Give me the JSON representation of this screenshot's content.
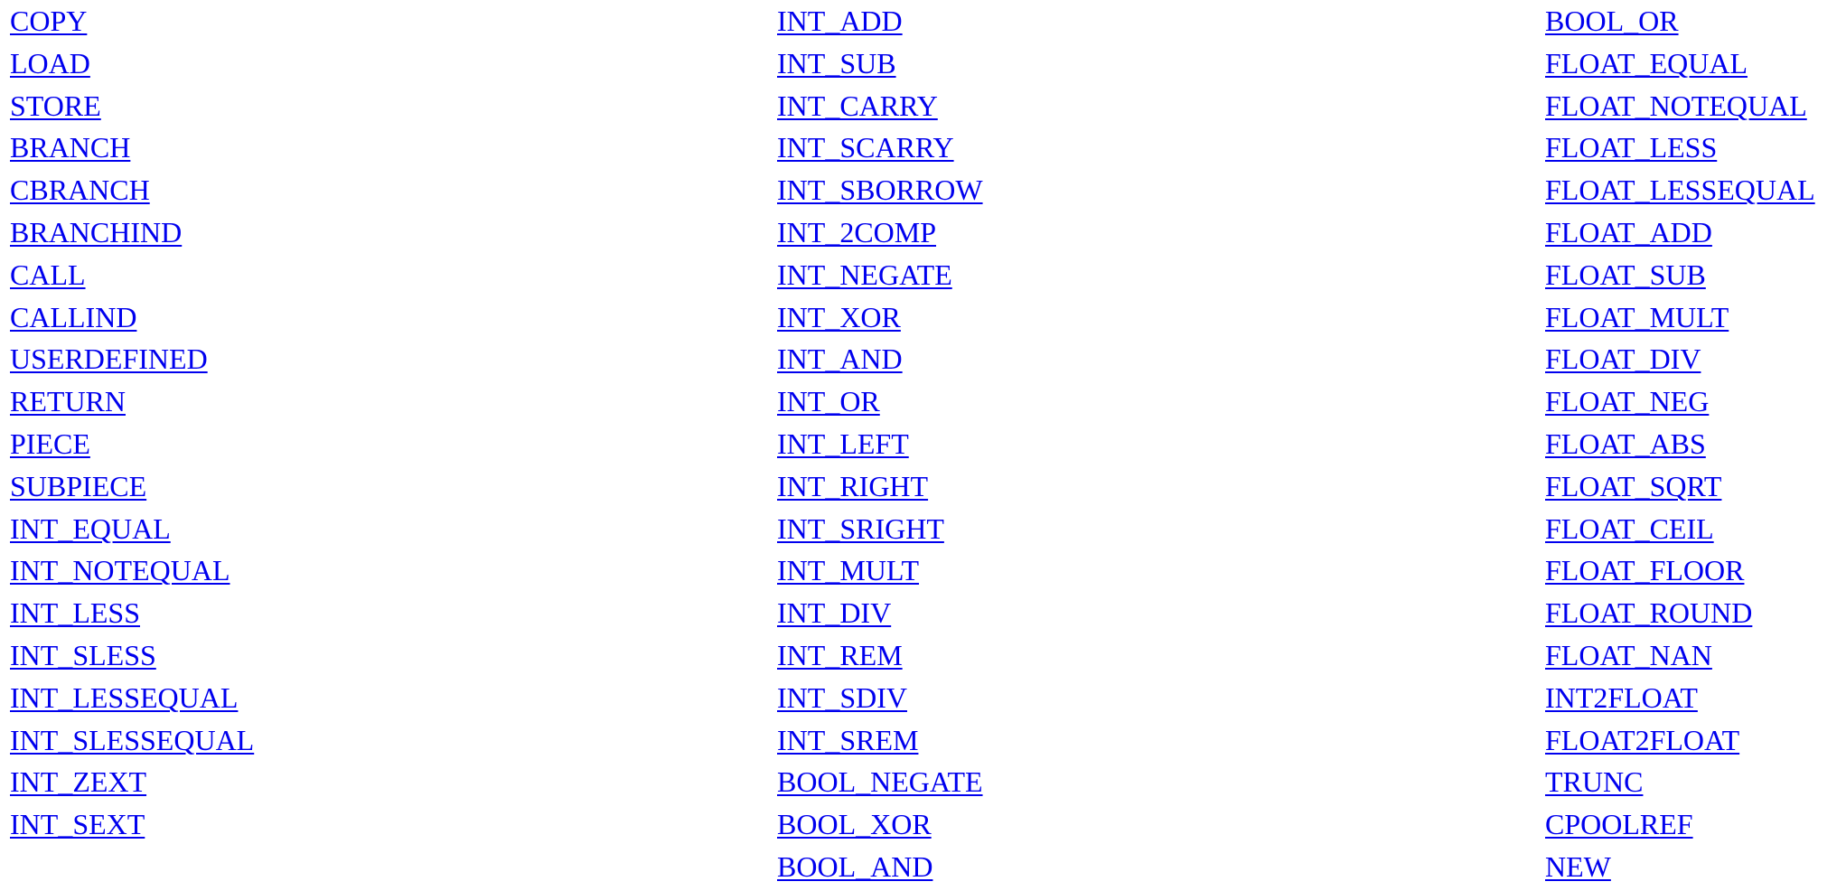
{
  "colors": {
    "link": "#0000ee",
    "background": "#ffffff"
  },
  "columns": [
    {
      "links": [
        "COPY",
        "LOAD",
        "STORE",
        "BRANCH",
        "CBRANCH",
        "BRANCHIND",
        "CALL",
        "CALLIND",
        "USERDEFINED",
        "RETURN",
        "PIECE",
        "SUBPIECE",
        "INT_EQUAL",
        "INT_NOTEQUAL",
        "INT_LESS",
        "INT_SLESS",
        "INT_LESSEQUAL",
        "INT_SLESSEQUAL",
        "INT_ZEXT",
        "INT_SEXT"
      ]
    },
    {
      "links": [
        "INT_ADD",
        "INT_SUB",
        "INT_CARRY",
        "INT_SCARRY",
        "INT_SBORROW",
        "INT_2COMP",
        "INT_NEGATE",
        "INT_XOR",
        "INT_AND",
        "INT_OR",
        "INT_LEFT",
        "INT_RIGHT",
        "INT_SRIGHT",
        "INT_MULT",
        "INT_DIV",
        "INT_REM",
        "INT_SDIV",
        "INT_SREM",
        "BOOL_NEGATE",
        "BOOL_XOR",
        "BOOL_AND"
      ]
    },
    {
      "links": [
        "BOOL_OR",
        "FLOAT_EQUAL",
        "FLOAT_NOTEQUAL",
        "FLOAT_LESS",
        "FLOAT_LESSEQUAL",
        "FLOAT_ADD",
        "FLOAT_SUB",
        "FLOAT_MULT",
        "FLOAT_DIV",
        "FLOAT_NEG",
        "FLOAT_ABS",
        "FLOAT_SQRT",
        "FLOAT_CEIL",
        "FLOAT_FLOOR",
        "FLOAT_ROUND",
        "FLOAT_NAN",
        "INT2FLOAT",
        "FLOAT2FLOAT",
        "TRUNC",
        "CPOOLREF",
        "NEW"
      ]
    }
  ]
}
